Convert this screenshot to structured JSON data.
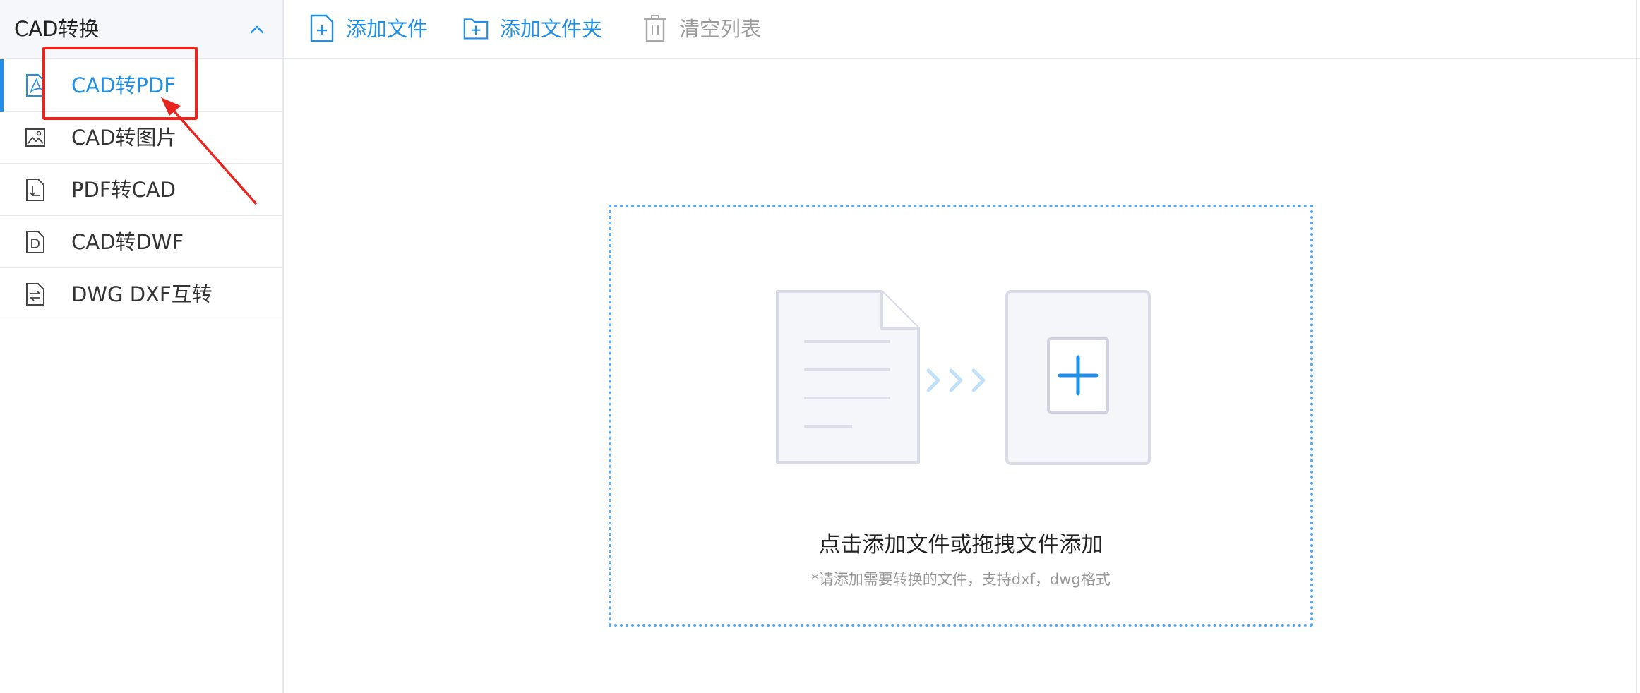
{
  "sidebar": {
    "title": "CAD转换",
    "items": [
      {
        "label": "CAD转PDF",
        "active": true,
        "icon": "pdf-file-icon"
      },
      {
        "label": "CAD转图片",
        "active": false,
        "icon": "image-file-icon"
      },
      {
        "label": "PDF转CAD",
        "active": false,
        "icon": "pdf-to-cad-icon"
      },
      {
        "label": "CAD转DWF",
        "active": false,
        "icon": "dwf-file-icon"
      },
      {
        "label": "DWG DXF互转",
        "active": false,
        "icon": "swap-file-icon"
      }
    ]
  },
  "toolbar": {
    "add_file": "添加文件",
    "add_folder": "添加文件夹",
    "clear_list": "清空列表"
  },
  "drop_zone": {
    "title": "点击添加文件或拖拽文件添加",
    "hint": "*请添加需要转换的文件，支持dxf，dwg格式"
  },
  "colors": {
    "accent": "#1f8fe8",
    "annotation": "#e8261f",
    "disabled": "#9b9b9b"
  }
}
